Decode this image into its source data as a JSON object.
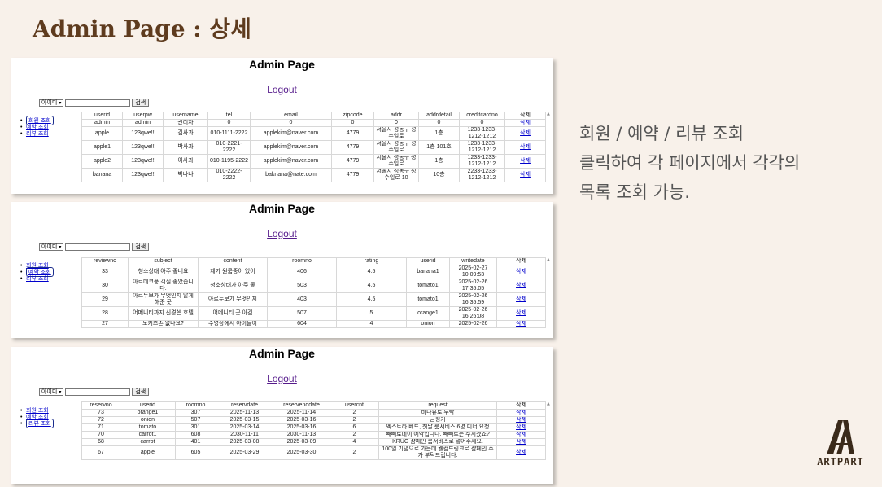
{
  "slide": {
    "title": "Admin Page : 상세",
    "description": [
      "회원 / 예약 / 리뷰 조회",
      "클릭하여 각 페이지에서 각각의",
      "목록 조회 가능."
    ],
    "logo_text": "ARTPART"
  },
  "common": {
    "page_title": "Admin Page",
    "logout": "Logout",
    "search_select": "아이디",
    "search_button": "검색",
    "nav": [
      "회원 조회",
      "예약 조회",
      "리뷰 조회"
    ],
    "delete_label": "삭제"
  },
  "members": {
    "columns": [
      "userid",
      "userpw",
      "username",
      "tel",
      "email",
      "zipcode",
      "addr",
      "addrdetail",
      "creditcardno",
      "삭제"
    ],
    "rows": [
      [
        "admin",
        "admin",
        "관리자",
        "0",
        "0",
        "0",
        "0",
        "0",
        "0",
        "삭제"
      ],
      [
        "apple",
        "123qwe!!",
        "김사과",
        "010-1111-2222",
        "applekim@naver.com",
        "4779",
        "서울시 성동구 성수일로",
        "1층",
        "1233-1233-1212-1212",
        "삭제"
      ],
      [
        "apple1",
        "123qwe!!",
        "박사과",
        "010-2221-2222",
        "applekim@naver.com",
        "4779",
        "서울시 성동구 성수일로",
        "1층 101호",
        "1233-1233-1212-1212",
        "삭제"
      ],
      [
        "apple2",
        "123qwe!!",
        "이사과",
        "010-1195-2222",
        "applekim@naver.com",
        "4779",
        "서울시 성동구 성수일로",
        "1층",
        "1233-1233-1212-1212",
        "삭제"
      ],
      [
        "banana",
        "123qwe!!",
        "박나나",
        "010-2222-2222",
        "baknana@nate.com",
        "4779",
        "서울시 성동구 성수일로 10",
        "10층",
        "2233-1233-1212-1212",
        "삭제"
      ]
    ]
  },
  "reviews": {
    "columns": [
      "reviewno",
      "subject",
      "content",
      "roomno",
      "rating",
      "userid",
      "writedate",
      "삭제"
    ],
    "rows": [
      [
        "33",
        "청소상태 아주 좋네요",
        "제가 원룸중이 있어",
        "406",
        "4.5",
        "banana1",
        "2025-02-27 10:09:53",
        "삭제"
      ],
      [
        "30",
        "아르데코풍 객실 좋았습니다.",
        "청소상태가 아주 좋",
        "503",
        "4.5",
        "tomato1",
        "2025-02-26 17:35:05",
        "삭제"
      ],
      [
        "29",
        "아르누보가 무엇인지 알게 해준 곳",
        "아르누보가 무엇인지",
        "403",
        "4.5",
        "tomato1",
        "2025-02-26 16:35:59",
        "삭제"
      ],
      [
        "28",
        "어메니티까지 신경쓴 호텔",
        "어메니티 굿 아검",
        "507",
        "5",
        "orange1",
        "2025-02-26 16:26:08",
        "삭제"
      ],
      [
        "27",
        "노키즈존 없나요?",
        "수영장에서 아이들이",
        "604",
        "4",
        "onion",
        "2025-02-26",
        "삭제"
      ]
    ]
  },
  "reservations": {
    "columns": [
      "reservno",
      "userid",
      "roomno",
      "reservdate",
      "reservenddate",
      "usercnt",
      "request",
      "삭제"
    ],
    "rows": [
      [
        "73",
        "orange1",
        "307",
        "2025-11-13",
        "2025-11-14",
        "2",
        "바다뷰로 부탁",
        "삭제"
      ],
      [
        "72",
        "onion",
        "507",
        "2025-03-15",
        "2025-03-16",
        "2",
        "금평기",
        "삭제"
      ],
      [
        "71",
        "tomato",
        "301",
        "2025-03-14",
        "2025-03-16",
        "6",
        "엑스트라 베드, 첫날 룸서비스 6명 디너 요청",
        "삭제"
      ],
      [
        "70",
        "carrot1",
        "608",
        "2030-11-11",
        "2030-11-13",
        "2",
        "빼빼로데이 예약입니다. 빼빼로는 주시겠죠?",
        "삭제"
      ],
      [
        "68",
        "carrot",
        "401",
        "2025-03-08",
        "2025-03-09",
        "4",
        "KRUG 샴페인 룸서비스로 넣어주세요.",
        "삭제"
      ],
      [
        "67",
        "apple",
        "605",
        "2025-03-29",
        "2025-03-30",
        "2",
        "100일 기념으로 가는데 웰컴드링크로 샴페인 주가 부탁드립니다.",
        "삭제"
      ]
    ]
  }
}
